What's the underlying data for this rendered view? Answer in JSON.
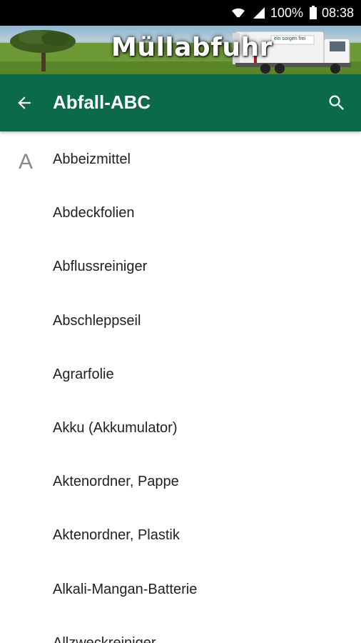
{
  "status_bar": {
    "battery": "100%",
    "time": "08:38"
  },
  "banner": {
    "title": "Müllabfuhr",
    "truck_text": "ein sorgen frei"
  },
  "app_bar": {
    "title": "Abfall-ABC",
    "back_icon": "arrow-left-icon",
    "search_icon": "search-icon"
  },
  "list": {
    "section_letter": "A",
    "items": [
      "Abbeizmittel",
      "Abdeckfolien",
      "Abflussreiniger",
      "Abschleppseil",
      "Agrarfolie",
      "Akku (Akkumulator)",
      "Aktenordner, Pappe",
      "Aktenordner, Plastik",
      "Alkali-Mangan-Batterie",
      "Allzweckreiniger"
    ]
  },
  "colors": {
    "app_bar": "#0b6a4a",
    "status_bar": "#000000",
    "section_letter": "#8a8a8a",
    "item_text": "#212121"
  }
}
